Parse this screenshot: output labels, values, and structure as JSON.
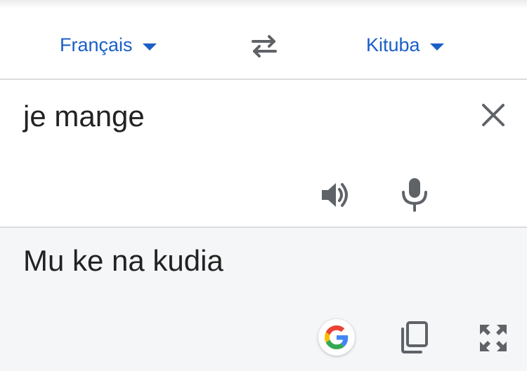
{
  "languages": {
    "source_label": "Français",
    "target_label": "Kituba"
  },
  "input": {
    "text": "je mange"
  },
  "output": {
    "text": "Mu ke na kudia"
  },
  "icons": {
    "source_caret": "chevron-down-icon",
    "swap": "swap-arrows-icon",
    "target_caret": "chevron-down-icon",
    "clear": "close-icon",
    "speaker": "speaker-icon",
    "mic": "microphone-icon",
    "google": "google-logo-icon",
    "copy": "copy-icon",
    "fullscreen": "fullscreen-icon"
  },
  "colors": {
    "accent": "#1a5fc8",
    "icon_gray": "#5f6368",
    "output_bg": "#f5f6f8",
    "google_blue": "#4285F4",
    "google_red": "#EA4335",
    "google_yellow": "#FBBC05",
    "google_green": "#34A853"
  }
}
